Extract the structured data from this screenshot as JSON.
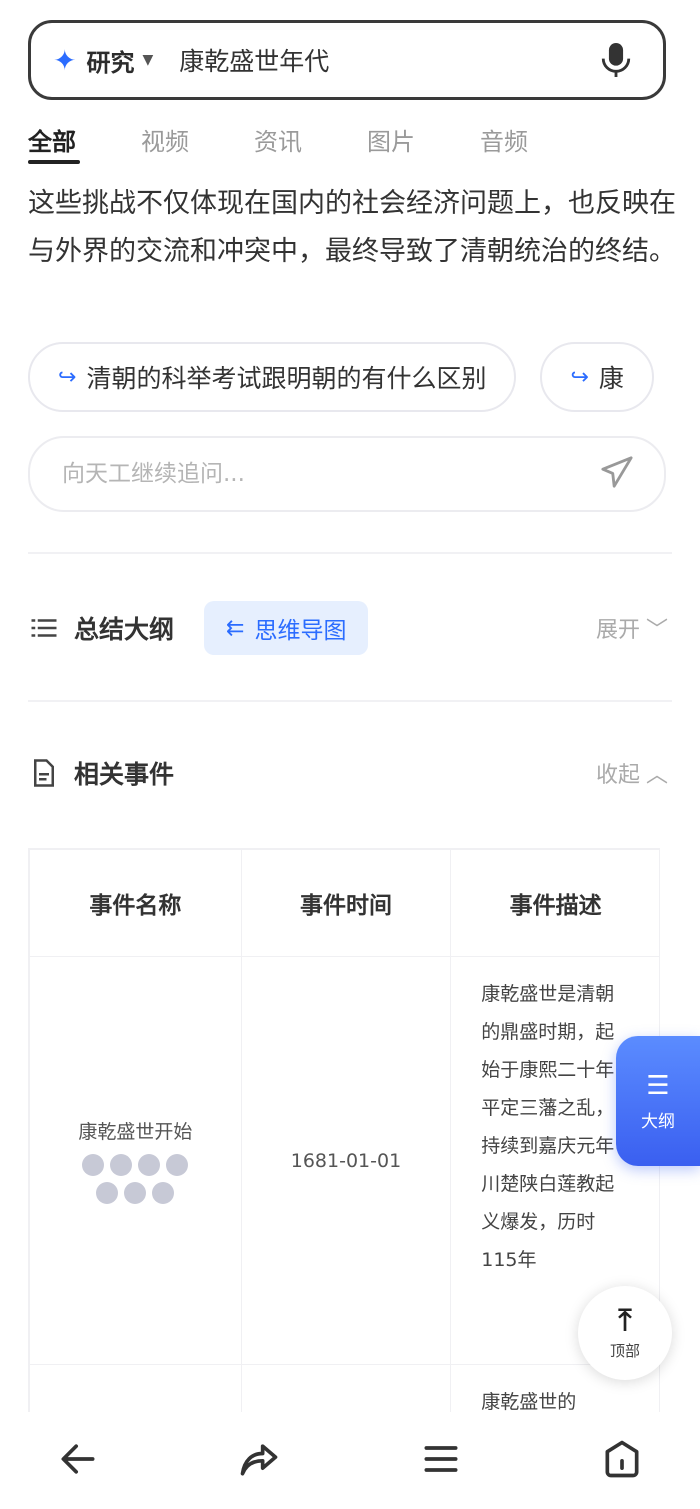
{
  "search": {
    "mode_label": "研究",
    "query": "康乾盛世年代"
  },
  "tabs": [
    {
      "label": "全部"
    },
    {
      "label": "视频"
    },
    {
      "label": "资讯"
    },
    {
      "label": "图片"
    },
    {
      "label": "音频"
    }
  ],
  "answer": {
    "paragraph": "这些挑战不仅体现在国内的社会经济问题上，也反映在与外界的交流和冲突中，最终导致了清朝统治的终结。"
  },
  "suggestions": [
    {
      "label": "清朝的科举考试跟明朝的有什么区别"
    },
    {
      "label": "康"
    }
  ],
  "followup": {
    "placeholder": "向天工继续追问..."
  },
  "outline_section": {
    "title": "总结大纲",
    "mindmap_label": "思维导图",
    "toggle_label": "展开"
  },
  "events_section": {
    "title": "相关事件",
    "toggle_label": "收起"
  },
  "events_table": {
    "headers": [
      "事件名称",
      "事件时间",
      "事件描述"
    ],
    "rows": [
      {
        "name": "康乾盛世开始",
        "time": "1681-01-01",
        "description": "康乾盛世是清朝的鼎盛时期，起始于康熙二十年平定三藩之乱，持续到嘉庆元年川楚陕白莲教起义爆发，历时115年"
      },
      {
        "name": "",
        "time": "",
        "description": "康乾盛世的"
      }
    ]
  },
  "floating": {
    "outline_label": "大纲",
    "top_label": "顶部"
  },
  "colors": {
    "accent": "#2b6cff",
    "chip_bg": "#e6effe"
  },
  "icons": {
    "back": "back-arrow-icon",
    "share": "share-icon",
    "menu": "menu-icon",
    "home": "home-icon"
  }
}
